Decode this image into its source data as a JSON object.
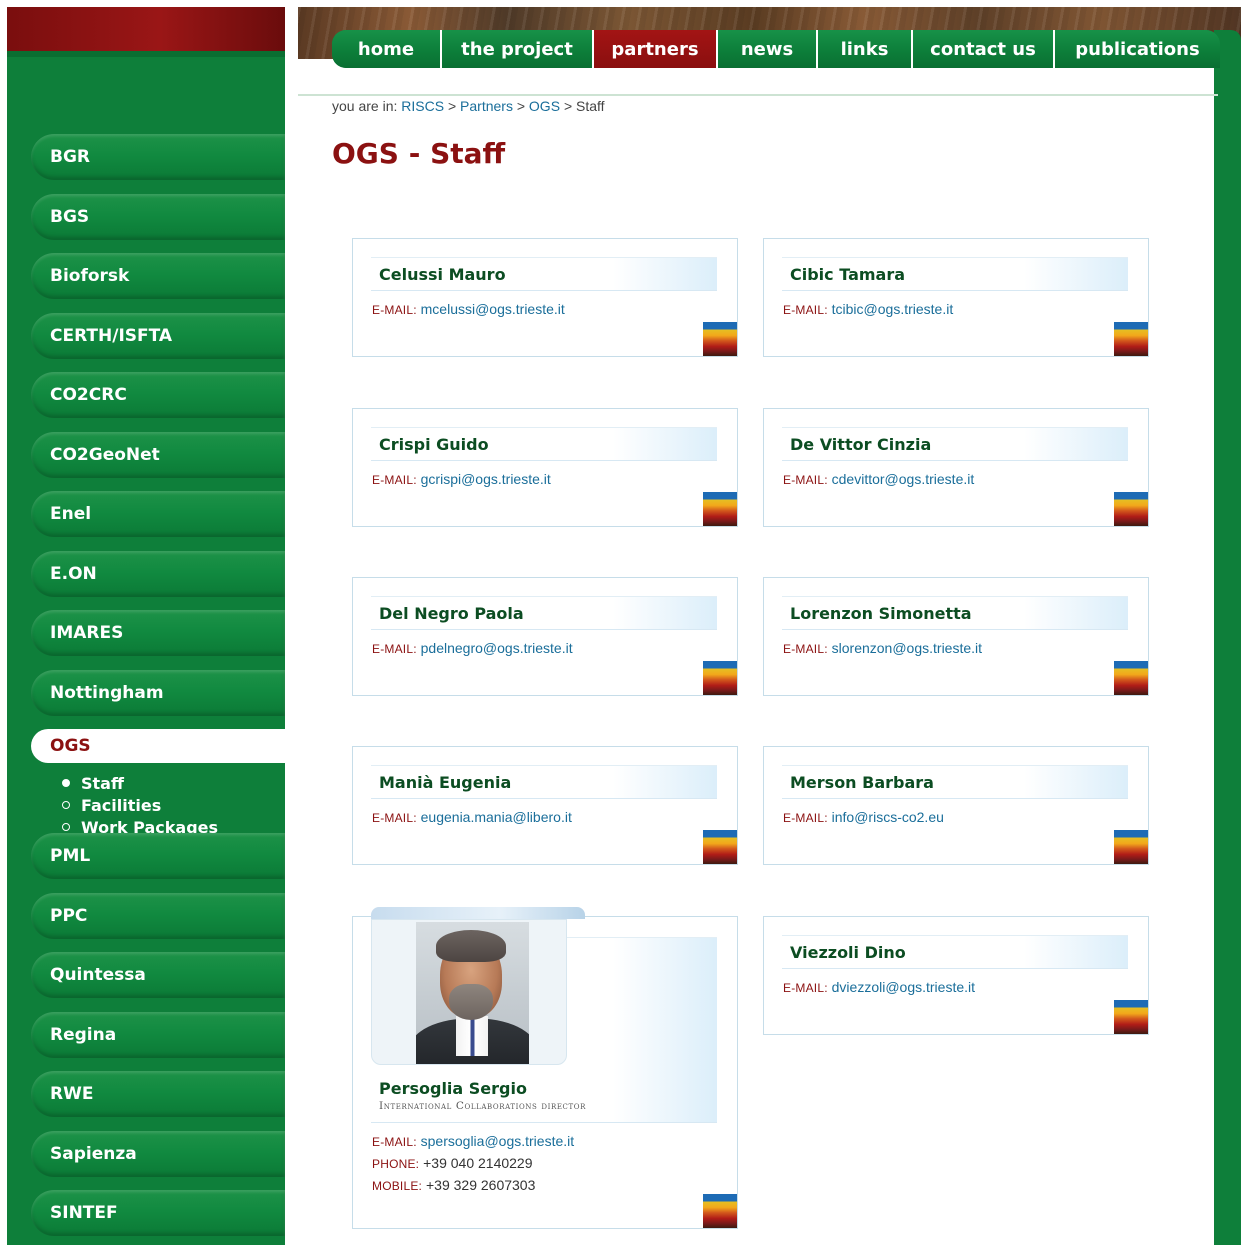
{
  "nav": {
    "tabs": [
      {
        "label": "home",
        "active": false
      },
      {
        "label": "the project",
        "active": false
      },
      {
        "label": "partners",
        "active": true
      },
      {
        "label": "news",
        "active": false
      },
      {
        "label": "links",
        "active": false
      },
      {
        "label": "contact us",
        "active": false
      },
      {
        "label": "publications",
        "active": false
      }
    ]
  },
  "breadcrumb": {
    "prefix": "you are in:",
    "items": [
      "RISCS",
      "Partners",
      "OGS",
      "Staff"
    ],
    "separator": ">"
  },
  "page_title": "OGS - Staff",
  "sidebar": {
    "partners_before": [
      "BGR",
      "BGS",
      "Bioforsk",
      "CERTH/ISFTA",
      "CO2CRC",
      "CO2GeoNet",
      "Enel",
      "E.ON",
      "IMARES",
      "Nottingham"
    ],
    "active_partner": "OGS",
    "sub_items": [
      {
        "label": "Staff",
        "current": true
      },
      {
        "label": "Facilities",
        "current": false
      },
      {
        "label": "Work Packages",
        "current": false
      }
    ],
    "partners_after": [
      "PML",
      "PPC",
      "Quintessa",
      "Regina",
      "RWE",
      "Sapienza",
      "SINTEF"
    ]
  },
  "labels": {
    "email": "E-MAIL:",
    "phone": "PHONE:",
    "mobile": "MOBILE:"
  },
  "staff": [
    {
      "name": "Celussi Mauro",
      "email": "mcelussi@ogs.trieste.it"
    },
    {
      "name": "Cibic Tamara",
      "email": "tcibic@ogs.trieste.it"
    },
    {
      "name": "Crispi Guido",
      "email": "gcrispi@ogs.trieste.it"
    },
    {
      "name": "De Vittor Cinzia",
      "email": "cdevittor@ogs.trieste.it"
    },
    {
      "name": "Del Negro Paola",
      "email": "pdelnegro@ogs.trieste.it"
    },
    {
      "name": "Lorenzon Simonetta",
      "email": "slorenzon@ogs.trieste.it"
    },
    {
      "name": "Manià Eugenia",
      "email": "eugenia.mania@libero.it"
    },
    {
      "name": "Merson Barbara",
      "email": "info@riscs-co2.eu"
    },
    {
      "name": "Persoglia Sergio",
      "role": "International Collaborations director",
      "email": "spersoglia@ogs.trieste.it",
      "phone": "+39 040 2140229",
      "mobile": "+39 329 2607303"
    },
    {
      "name": "Viezzoli Dino",
      "email": "dviezzoli@ogs.trieste.it"
    }
  ],
  "colors": {
    "green": "#0e7f3a",
    "dark_red": "#8b1111",
    "link_blue": "#1a6e9a"
  }
}
